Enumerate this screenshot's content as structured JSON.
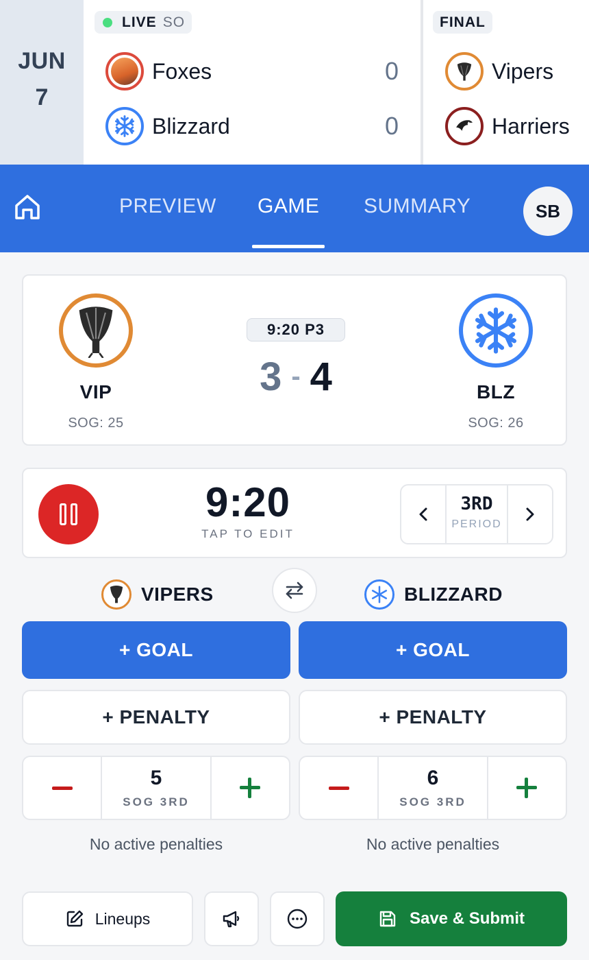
{
  "ticker": {
    "date": {
      "month": "JUN",
      "day": "7"
    },
    "games": [
      {
        "status": "LIVE",
        "status_extra": "SO",
        "teams": [
          {
            "name": "Foxes",
            "score": "0",
            "logo": "fox-logo"
          },
          {
            "name": "Blizzard",
            "score": "0",
            "logo": "snowflake-logo"
          }
        ]
      },
      {
        "status": "FINAL",
        "teams": [
          {
            "name": "Vipers",
            "logo": "viper-logo"
          },
          {
            "name": "Harriers",
            "logo": "harrier-logo"
          }
        ]
      }
    ]
  },
  "nav": {
    "home_icon": "home-icon",
    "tabs": [
      {
        "label": "PREVIEW",
        "active": false
      },
      {
        "label": "GAME",
        "active": true
      },
      {
        "label": "SUMMARY",
        "active": false
      }
    ],
    "avatar_initials": "SB"
  },
  "scoreboard": {
    "clock": "9:20 P3",
    "home": {
      "abbr": "VIP",
      "sog": "SOG: 25",
      "score": "3"
    },
    "separator": "-",
    "away": {
      "abbr": "BLZ",
      "sog": "SOG: 26",
      "score": "4"
    }
  },
  "clock_control": {
    "time": "9:20",
    "hint": "TAP TO EDIT",
    "period_value": "3RD",
    "period_label": "PERIOD",
    "pause_icon": "pause-icon"
  },
  "teams": {
    "left": {
      "name": "VIPERS",
      "goal_label": "+ GOAL",
      "penalty_label": "+ PENALTY",
      "sog_value": "5",
      "sog_label": "SOG 3RD",
      "penalties_text": "No active penalties"
    },
    "right": {
      "name": "BLIZZARD",
      "goal_label": "+ GOAL",
      "penalty_label": "+ PENALTY",
      "sog_value": "6",
      "sog_label": "SOG 3RD",
      "penalties_text": "No active penalties"
    }
  },
  "toolbar": {
    "lineups_label": "Lineups",
    "save_label": "Save & Submit",
    "icons": [
      "edit-icon",
      "megaphone-icon",
      "more-icon",
      "save-icon"
    ]
  },
  "colors": {
    "primary": "#2f6fdf",
    "live": "#4ade80",
    "pause": "#dc2626",
    "save": "#15803d",
    "minus": "#c51b1b",
    "plus": "#15803d"
  }
}
